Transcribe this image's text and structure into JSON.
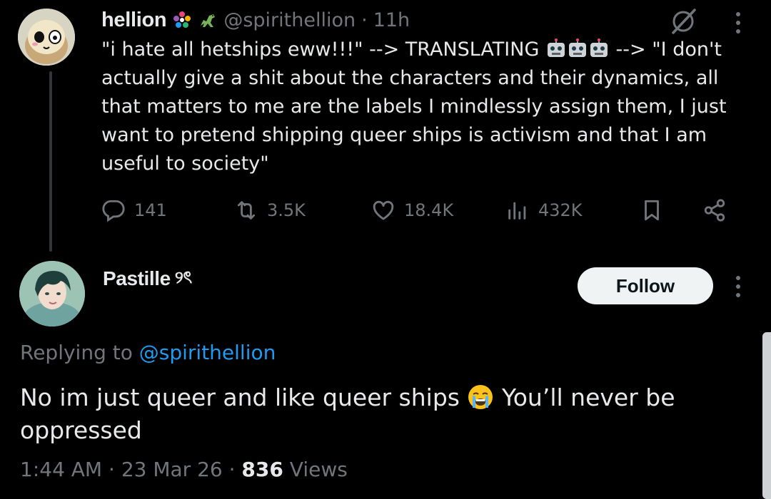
{
  "parent": {
    "display_name": "hellion",
    "handle": "@spirithellion",
    "time": "11h",
    "separator": "·",
    "text_part1": "\"i hate all hetships eww!!!\" --> TRANSLATING ",
    "text_part2": " --> \"I don't actually give a shit about the characters and their dynamics, all that matters to me are the labels I mindlessly assign them, I just want to pretend shipping queer ships is activism and that I am useful to society\"",
    "actions": {
      "replies": "141",
      "reposts": "3.5K",
      "likes": "18.4K",
      "views": "432K"
    }
  },
  "reply": {
    "display_name": "Pastille",
    "name_suffix": "୨ৎ",
    "follow_label": "Follow",
    "replying_prefix": "Replying to ",
    "replying_handle": "@spirithellion",
    "text_part1": "No im just queer and like queer ships ",
    "text_part2": " You’ll never be oppressed",
    "time": "1:44 AM",
    "date": "23 Mar 26",
    "views_count": "836",
    "views_label": " Views"
  },
  "colors": {
    "background": "#000000",
    "text": "#e7e9ea",
    "muted": "#71767b",
    "link": "#1d9bf0"
  },
  "icons": [
    "more-icon",
    "grok-icon",
    "reply-icon",
    "repost-icon",
    "like-icon",
    "views-icon",
    "bookmark-icon",
    "share-icon",
    "robot-emoji",
    "crying-emoji"
  ]
}
